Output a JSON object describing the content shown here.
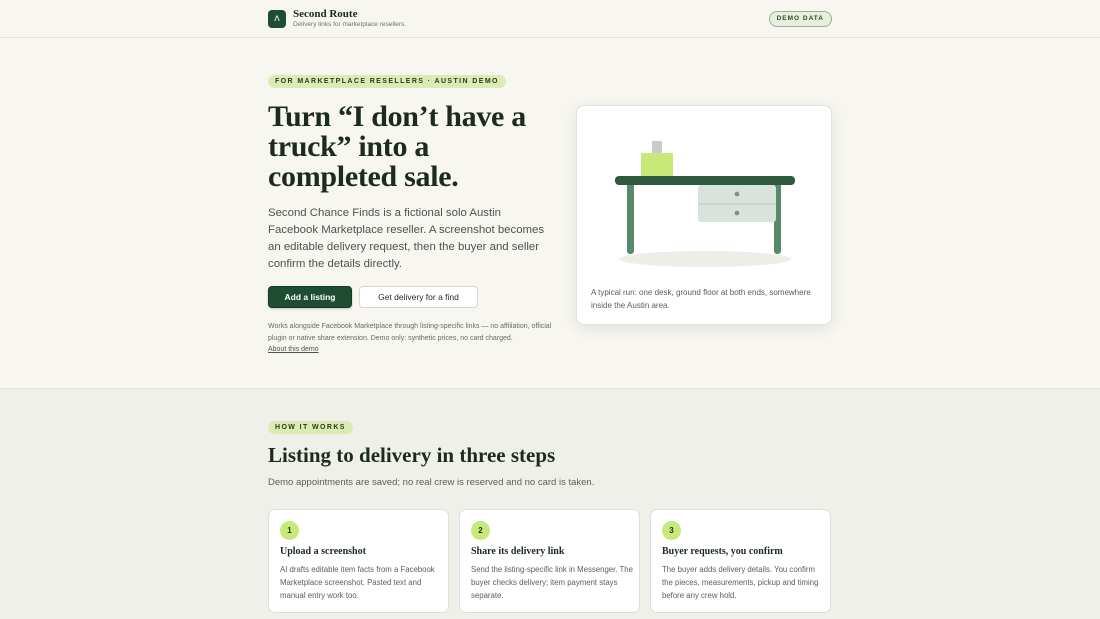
{
  "header": {
    "logo_glyph": "ʌ",
    "brand_name": "Second Route",
    "tagline": "Delivery links for marketplace resellers.",
    "demo_badge": "DEMO DATA"
  },
  "hero": {
    "eyebrow": "FOR MARKETPLACE RESELLERS · AUSTIN DEMO",
    "title": "Turn “I don’t have a truck” into a completed sale.",
    "body": "Second Chance Finds is a fictional solo Austin Facebook Marketplace reseller. A screenshot becomes an editable delivery request, then the buyer and seller confirm the details directly.",
    "primary_button": "Add a listing",
    "secondary_button": "Get delivery for a find",
    "fineprint": "Works alongside Facebook Marketplace through listing-specific links — no affiliation, official plugin or native share extension. Demo only: synthetic prices, no card charged.",
    "about_link": "About this demo"
  },
  "illustration": {
    "caption": "A typical run: one desk, ground floor at both ends, somewhere inside the Austin area."
  },
  "how_it_works": {
    "eyebrow": "HOW IT WORKS",
    "title": "Listing to delivery in three steps",
    "subtitle": "Demo appointments are saved; no real crew is reserved and no card is taken.",
    "steps": [
      {
        "number": "1",
        "title": "Upload a screenshot",
        "body": "AI drafts editable item facts from a Facebook Marketplace screenshot. Pasted text and manual entry work too."
      },
      {
        "number": "2",
        "title": "Share its delivery link",
        "body": "Send the listing-specific link in Messenger. The buyer checks delivery; item payment stays separate."
      },
      {
        "number": "3",
        "title": "Buyer requests, you confirm",
        "body": "The buyer adds delivery details. You confirm the pieces, measurements, pickup and timing before any crew hold."
      }
    ]
  },
  "colors": {
    "brand_green": "#1f4d33",
    "accent_lime": "#c9e87a",
    "background": "#f7f6f1"
  }
}
